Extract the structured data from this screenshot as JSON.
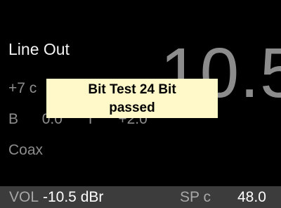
{
  "screen": {
    "line_title": "Line Out",
    "big_value": "10.5",
    "gain_partial": "+7 c",
    "tone_b": "B",
    "tone_value": "0.0",
    "tone_sep": "T",
    "tone_treble": "+2.0",
    "input_label": "Coax"
  },
  "popup": {
    "line1": "Bit Test 24 Bit",
    "line2": "passed"
  },
  "status": {
    "vol_label": "VOL",
    "vol_value": "-10.5 dBr",
    "sp_label": "SP c",
    "sp_value": "48.0"
  }
}
